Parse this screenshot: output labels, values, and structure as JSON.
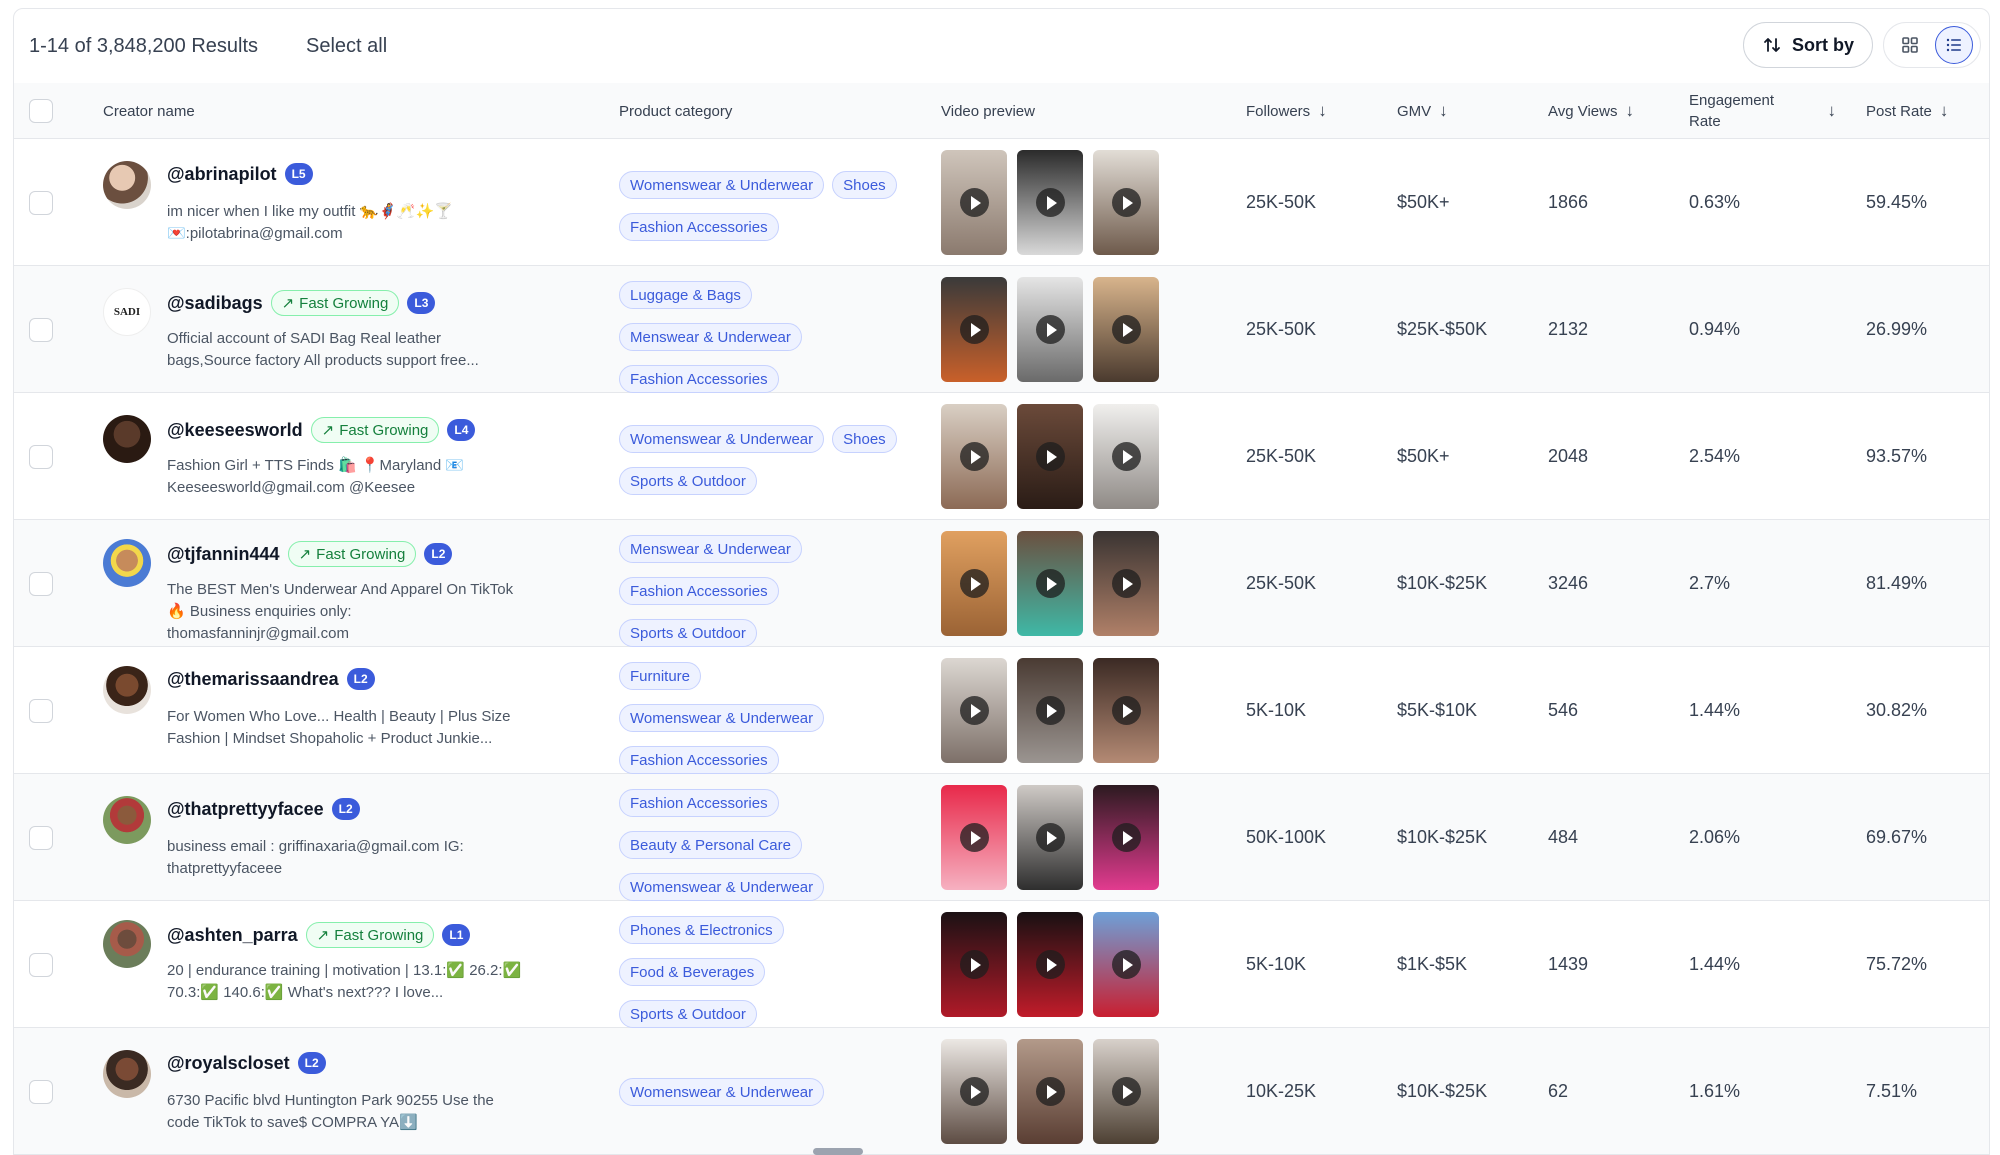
{
  "header": {
    "results": "1-14 of 3,848,200 Results",
    "select_all": "Select all",
    "sort_label": "Sort by",
    "grid_icon": "grid-view-icon",
    "list_icon": "list-view-icon"
  },
  "columns": {
    "creator": "Creator name",
    "category": "Product category",
    "video": "Video preview",
    "followers": "Followers",
    "gmv": "GMV",
    "avg_views": "Avg Views",
    "engagement_line1": "Engagement",
    "engagement_line2": "Rate",
    "post_rate": "Post Rate"
  },
  "rows": [
    {
      "handle": "@abrinapilot",
      "fast_growing": "",
      "level": "L5",
      "bio": "im nicer when I like my outfit 🐆🦸‍♀️🥂✨🍸 💌:pilotabrina@gmail.com",
      "categories": [
        "Womenswear & Underwear",
        "Shoes",
        "Fashion Accessories"
      ],
      "followers": "25K-50K",
      "gmv": "$50K+",
      "avg_views": "1866",
      "engagement": "0.63%",
      "post_rate": "59.45%"
    },
    {
      "handle": "@sadibags",
      "fast_growing": "Fast Growing",
      "level": "L3",
      "bio": "Official account of SADI Bag Real leather bags,Source factory All products support free...",
      "categories": [
        "Luggage & Bags",
        "Menswear & Underwear",
        "Fashion Accessories"
      ],
      "followers": "25K-50K",
      "gmv": "$25K-$50K",
      "avg_views": "2132",
      "engagement": "0.94%",
      "post_rate": "26.99%"
    },
    {
      "handle": "@keeseesworld",
      "fast_growing": "Fast Growing",
      "level": "L4",
      "bio": "Fashion Girl + TTS Finds 🛍️ 📍Maryland 📧 Keeseesworld@gmail.com @Keesee",
      "categories": [
        "Womenswear & Underwear",
        "Shoes",
        "Sports & Outdoor"
      ],
      "followers": "25K-50K",
      "gmv": "$50K+",
      "avg_views": "2048",
      "engagement": "2.54%",
      "post_rate": "93.57%"
    },
    {
      "handle": "@tjfannin444",
      "fast_growing": "Fast Growing",
      "level": "L2",
      "bio": "The BEST Men's Underwear And Apparel On TikTok 🔥 Business enquiries only: thomasfanninjr@gmail.com",
      "categories": [
        "Menswear & Underwear",
        "Fashion Accessories",
        "Sports & Outdoor"
      ],
      "followers": "25K-50K",
      "gmv": "$10K-$25K",
      "avg_views": "3246",
      "engagement": "2.7%",
      "post_rate": "81.49%"
    },
    {
      "handle": "@themarissaandrea",
      "fast_growing": "",
      "level": "L2",
      "bio": "For Women Who Love... Health | Beauty | Plus Size Fashion | Mindset Shopaholic + Product Junkie...",
      "categories": [
        "Furniture",
        "Womenswear & Underwear",
        "Fashion Accessories"
      ],
      "followers": "5K-10K",
      "gmv": "$5K-$10K",
      "avg_views": "546",
      "engagement": "1.44%",
      "post_rate": "30.82%"
    },
    {
      "handle": "@thatprettyyfacee",
      "fast_growing": "",
      "level": "L2",
      "bio": "business email : griffinaxaria@gmail.com IG: thatprettyyfaceee",
      "categories": [
        "Fashion Accessories",
        "Beauty & Personal Care",
        "Womenswear & Underwear"
      ],
      "followers": "50K-100K",
      "gmv": "$10K-$25K",
      "avg_views": "484",
      "engagement": "2.06%",
      "post_rate": "69.67%"
    },
    {
      "handle": "@ashten_parra",
      "fast_growing": "Fast Growing",
      "level": "L1",
      "bio": "20 | endurance training | motivation | 13.1:✅ 26.2:✅ 70.3:✅ 140.6:✅ What's next??? I love...",
      "categories": [
        "Phones & Electronics",
        "Food & Beverages",
        "Sports & Outdoor"
      ],
      "followers": "5K-10K",
      "gmv": "$1K-$5K",
      "avg_views": "1439",
      "engagement": "1.44%",
      "post_rate": "75.72%"
    },
    {
      "handle": "@royalscloset",
      "fast_growing": "",
      "level": "L2",
      "bio": "6730 Pacific blvd Huntington Park 90255 Use the code TikTok to save$ COMPRA YA⬇️",
      "categories": [
        "Womenswear & Underwear"
      ],
      "followers": "10K-25K",
      "gmv": "$10K-$25K",
      "avg_views": "62",
      "engagement": "1.61%",
      "post_rate": "7.51%"
    }
  ],
  "colors": {
    "accent": "#3b5bdb",
    "chip_bg": "#eef2ff",
    "fast_growing": "#15803d"
  }
}
